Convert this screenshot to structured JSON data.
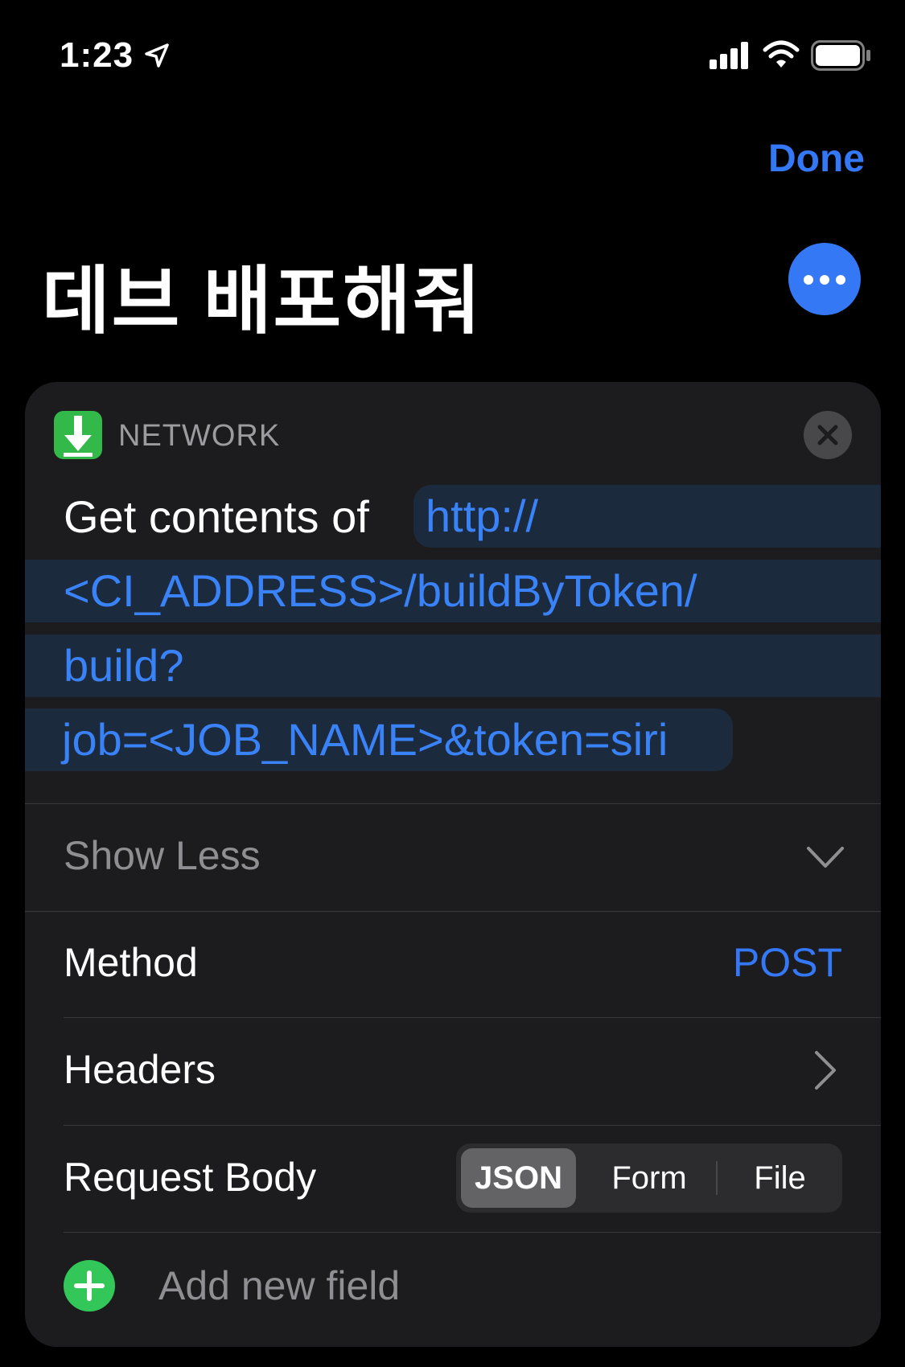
{
  "status_bar": {
    "time": "1:23",
    "icons": [
      "location-arrow-icon",
      "cellular-signal-icon",
      "wifi-icon",
      "battery-icon"
    ]
  },
  "nav": {
    "done_label": "Done"
  },
  "shortcut": {
    "title": "데브 배포해줘",
    "more_icon": "ellipsis-icon"
  },
  "action": {
    "category": "NETWORK",
    "category_icon": "download-arrow-icon",
    "text": "Get contents of",
    "url_lines": [
      "http://",
      "<CI_ADDRESS>/buildByToken/",
      "build?",
      "job=<JOB_NAME>&token=siri"
    ],
    "show_less_label": "Show Less",
    "method": {
      "label": "Method",
      "value": "POST"
    },
    "headers": {
      "label": "Headers"
    },
    "request_body": {
      "label": "Request Body",
      "options": [
        "JSON",
        "Form",
        "File"
      ],
      "selected": "JSON"
    },
    "add_field_label": "Add new field"
  },
  "colors": {
    "accent": "#3478f6",
    "token_bg": "#1c2a3e",
    "network_green": "#33b94a",
    "add_green": "#33c759",
    "card_bg": "#1c1c1e"
  }
}
